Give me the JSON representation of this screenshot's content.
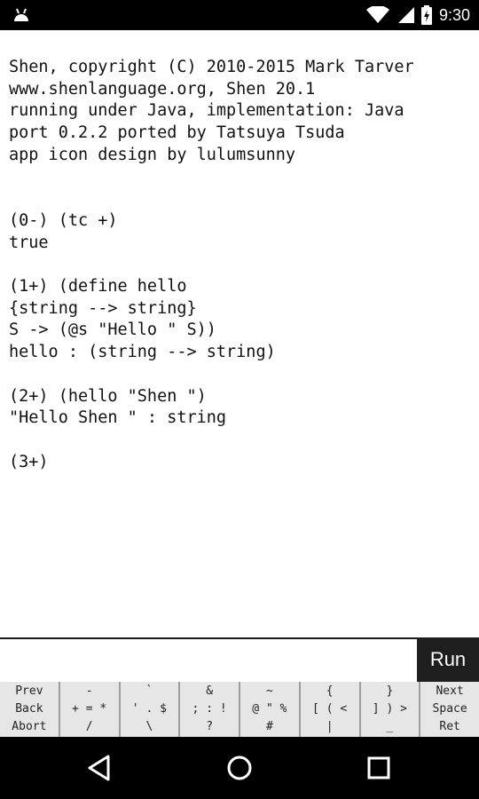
{
  "status_bar": {
    "time": "9:30",
    "app_icon": "android-notification-icon",
    "wifi_icon": "wifi-icon",
    "signal_icon": "signal-icon",
    "battery_icon": "battery-charging-icon"
  },
  "console": {
    "lines": [
      "Shen, copyright (C) 2010-2015 Mark Tarver",
      "www.shenlanguage.org, Shen 20.1",
      "running under Java, implementation: Java",
      "port 0.2.2 ported by Tatsuya Tsuda",
      "app icon design by lulumsunny",
      "",
      "",
      "(0-) (tc +)",
      "true",
      "",
      "(1+) (define hello",
      "{string --> string}",
      "S -> (@s \"Hello \" S))",
      "hello : (string --> string)",
      "",
      "(2+) (hello \"Shen \")",
      "\"Hello Shen \" : string",
      "",
      "(3+)"
    ]
  },
  "input": {
    "value": "",
    "placeholder": ""
  },
  "run_button": {
    "label": "Run"
  },
  "keys": [
    {
      "name": "key-navigation-left",
      "lines": [
        "Prev",
        "Back",
        "Abort"
      ]
    },
    {
      "name": "key-arithmetic",
      "lines": [
        "-",
        "+ = *",
        "/"
      ]
    },
    {
      "name": "key-quotes",
      "lines": [
        "`",
        "' . $",
        "\\"
      ]
    },
    {
      "name": "key-punctuation",
      "lines": [
        "&",
        "; : !",
        "?"
      ]
    },
    {
      "name": "key-symbols",
      "lines": [
        "~",
        "@ \" %",
        "#"
      ]
    },
    {
      "name": "key-open-brackets",
      "lines": [
        "{",
        "[ ( <",
        "|"
      ]
    },
    {
      "name": "key-close-brackets",
      "lines": [
        "}",
        "] ) >",
        "_"
      ]
    },
    {
      "name": "key-navigation-right",
      "lines": [
        "Next",
        "Space",
        "Ret"
      ]
    }
  ],
  "nav_bar": {
    "back_icon": "back-triangle-icon",
    "home_icon": "home-circle-icon",
    "recents_icon": "recents-square-icon"
  },
  "colors": {
    "status_bar_bg": "#000000",
    "console_bg": "#ffffff",
    "run_button_bg": "#1e1e1e",
    "key_bg": "#e6e6e6"
  }
}
